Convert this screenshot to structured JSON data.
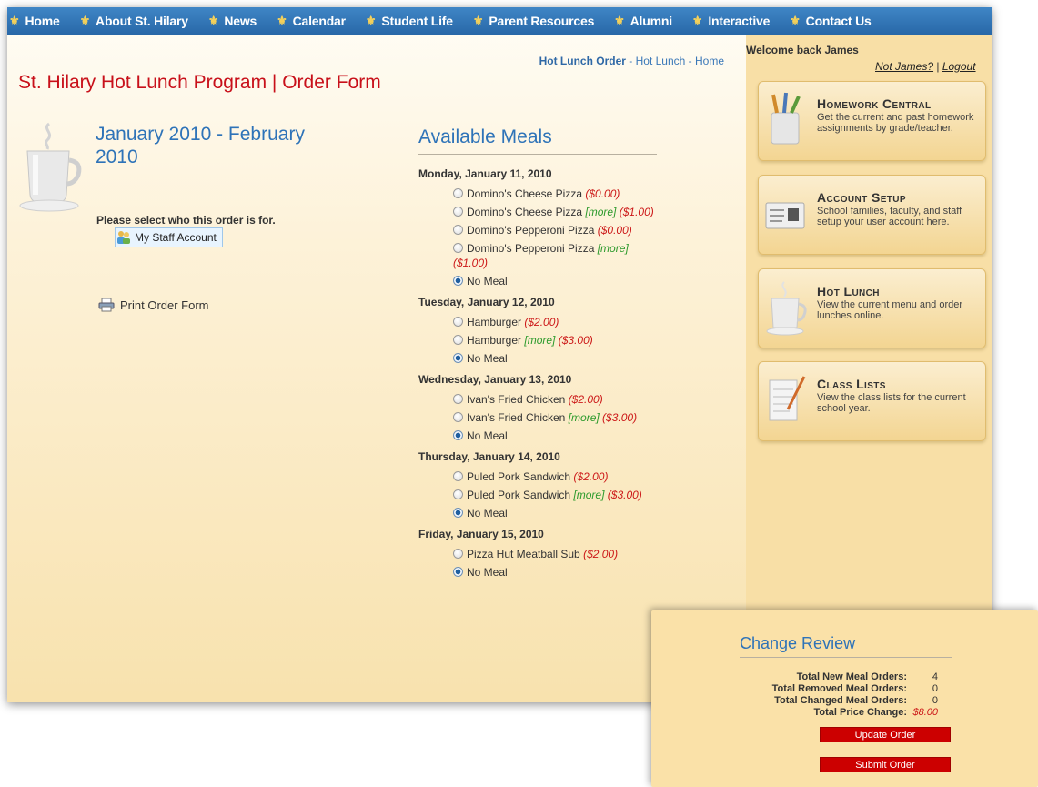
{
  "nav": {
    "items": [
      {
        "label": "Home",
        "icon": "fleur-de-lis-icon"
      },
      {
        "label": "About St. Hilary",
        "icon": "fleur-de-lis-icon"
      },
      {
        "label": "News",
        "icon": "fleur-de-lis-icon"
      },
      {
        "label": "Calendar",
        "icon": "fleur-de-lis-icon"
      },
      {
        "label": "Student Life",
        "icon": "fleur-de-lis-icon"
      },
      {
        "label": "Parent Resources",
        "icon": "fleur-de-lis-icon"
      },
      {
        "label": "Alumni",
        "icon": "fleur-de-lis-icon"
      },
      {
        "label": "Interactive",
        "icon": "fleur-de-lis-icon"
      },
      {
        "label": "Contact Us",
        "icon": "fleur-de-lis-icon"
      }
    ],
    "bar_color": "#2f74b8",
    "icon_color": "#f5d15a"
  },
  "breadcrumb": {
    "current": "Hot Lunch Order",
    "sep": " - ",
    "link1": "Hot Lunch",
    "link2": "Home"
  },
  "page_title": "St. Hilary Hot Lunch Program | Order Form",
  "date_range": "January 2010 - February 2010",
  "order_for": {
    "label": "Please select who this order is for.",
    "account": "My Staff Account"
  },
  "print_label": "Print Order Form",
  "meals": {
    "heading": "Available Meals",
    "days": [
      {
        "date": "Monday, January 11, 2010",
        "options": [
          {
            "name": "Domino's Cheese Pizza",
            "more": "",
            "price": "($0.00)",
            "selected": false
          },
          {
            "name": "Domino's Cheese Pizza",
            "more": "[more]",
            "price": "($1.00)",
            "selected": false
          },
          {
            "name": "Domino's Pepperoni Pizza",
            "more": "",
            "price": "($0.00)",
            "selected": false
          },
          {
            "name": "Domino's Pepperoni Pizza",
            "more": "[more]",
            "price": "($1.00)",
            "selected": false
          },
          {
            "name": "No Meal",
            "more": "",
            "price": "",
            "selected": true
          }
        ]
      },
      {
        "date": "Tuesday, January 12, 2010",
        "options": [
          {
            "name": "Hamburger",
            "more": "",
            "price": "($2.00)",
            "selected": false
          },
          {
            "name": "Hamburger",
            "more": "[more]",
            "price": "($3.00)",
            "selected": false
          },
          {
            "name": "No Meal",
            "more": "",
            "price": "",
            "selected": true
          }
        ]
      },
      {
        "date": "Wednesday, January 13, 2010",
        "options": [
          {
            "name": "Ivan's Fried Chicken",
            "more": "",
            "price": "($2.00)",
            "selected": false
          },
          {
            "name": "Ivan's Fried Chicken",
            "more": "[more]",
            "price": "($3.00)",
            "selected": false
          },
          {
            "name": "No Meal",
            "more": "",
            "price": "",
            "selected": true
          }
        ]
      },
      {
        "date": "Thursday, January 14, 2010",
        "options": [
          {
            "name": "Puled Pork Sandwich",
            "more": "",
            "price": "($2.00)",
            "selected": false
          },
          {
            "name": "Puled Pork Sandwich",
            "more": "[more]",
            "price": "($3.00)",
            "selected": false
          },
          {
            "name": "No Meal",
            "more": "",
            "price": "",
            "selected": true
          }
        ]
      },
      {
        "date": "Friday, January 15, 2010",
        "options": [
          {
            "name": "Pizza Hut Meatball Sub",
            "more": "",
            "price": "($2.00)",
            "selected": false
          },
          {
            "name": "No Meal",
            "more": "",
            "price": "",
            "selected": true
          }
        ]
      }
    ]
  },
  "user": {
    "welcome": "Welcome back James",
    "not_user": "Not James?",
    "sep": " | ",
    "logout": "Logout"
  },
  "side_cards": [
    {
      "title": "Homework Central",
      "desc": "Get the current and past homework assignments by grade/teacher.",
      "icon": "pencil-cup-icon"
    },
    {
      "title": "Account Setup",
      "desc": "School families, faculty, and staff setup your user account here.",
      "icon": "id-card-icon"
    },
    {
      "title": "Hot Lunch",
      "desc": "View the current menu and order lunches online.",
      "icon": "coffee-cup-icon"
    },
    {
      "title": "Class Lists",
      "desc": "View the class lists for the current school year.",
      "icon": "notepad-icon"
    }
  ],
  "review": {
    "title": "Change Review",
    "rows": [
      {
        "label": "Total New Meal Orders:",
        "value": "4"
      },
      {
        "label": "Total Removed Meal Orders:",
        "value": "0"
      },
      {
        "label": "Total Changed Meal Orders:",
        "value": "0"
      },
      {
        "label": "Total Price Change:",
        "value": "$8.00"
      }
    ],
    "update_label": "Update Order",
    "submit_label": "Submit Order"
  },
  "colors": {
    "title_red": "#c8101a",
    "heading_blue": "#2e73b8",
    "price_red": "#cc1818",
    "more_green": "#2c9a2c",
    "button_red": "#cc0000"
  }
}
